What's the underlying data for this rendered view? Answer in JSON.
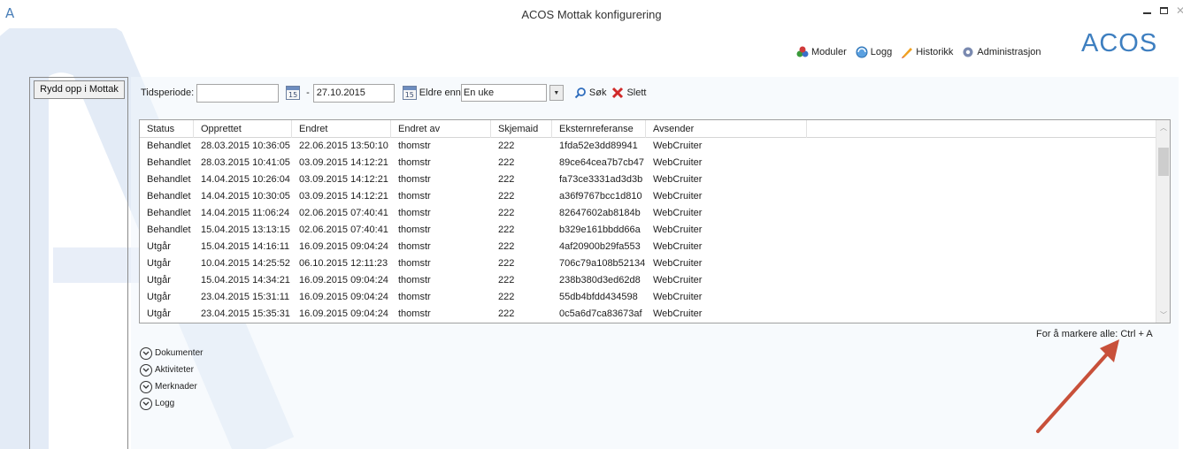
{
  "window": {
    "title": "ACOS Mottak konfigurering",
    "app_icon": "A"
  },
  "brand": {
    "logo_text": "ACOS",
    "accent": "#3e7fc0"
  },
  "topnav": {
    "items": [
      {
        "label": "Moduler",
        "icon": "modules-icon"
      },
      {
        "label": "Logg",
        "icon": "log-icon"
      },
      {
        "label": "Historikk",
        "icon": "history-icon"
      },
      {
        "label": "Administrasjon",
        "icon": "admin-icon"
      }
    ]
  },
  "leftpanel": {
    "button_label": "Rydd opp i Mottak"
  },
  "toolbar": {
    "period_label": "Tidsperiode:",
    "from_value": "",
    "dash": "-",
    "to_value": "27.10.2015",
    "cal_text": "15",
    "older_label": "Eldre enn",
    "older_value": "En uke",
    "search_label": "Søk",
    "delete_label": "Slett"
  },
  "grid": {
    "columns": [
      "Status",
      "Opprettet",
      "Endret",
      "Endret av",
      "Skjemaid",
      "Eksternreferanse",
      "Avsender"
    ],
    "rows": [
      [
        "Behandlet",
        "28.03.2015 10:36:05",
        "22.06.2015 13:50:10",
        "thomstr",
        "222",
        "1fda52e3dd89941",
        "WebCruiter"
      ],
      [
        "Behandlet",
        "28.03.2015 10:41:05",
        "03.09.2015 14:12:21",
        "thomstr",
        "222",
        "89ce64cea7b7cb47",
        "WebCruiter"
      ],
      [
        "Behandlet",
        "14.04.2015 10:26:04",
        "03.09.2015 14:12:21",
        "thomstr",
        "222",
        "fa73ce3331ad3d3b",
        "WebCruiter"
      ],
      [
        "Behandlet",
        "14.04.2015 10:30:05",
        "03.09.2015 14:12:21",
        "thomstr",
        "222",
        "a36f9767bcc1d810",
        "WebCruiter"
      ],
      [
        "Behandlet",
        "14.04.2015 11:06:24",
        "02.06.2015 07:40:41",
        "thomstr",
        "222",
        "82647602ab8184b",
        "WebCruiter"
      ],
      [
        "Behandlet",
        "15.04.2015 13:13:15",
        "02.06.2015 07:40:41",
        "thomstr",
        "222",
        "b329e161bbdd66a",
        "WebCruiter"
      ],
      [
        "Utgår",
        "15.04.2015 14:16:11",
        "16.09.2015 09:04:24",
        "thomstr",
        "222",
        "4af20900b29fa553",
        "WebCruiter"
      ],
      [
        "Utgår",
        "10.04.2015 14:25:52",
        "06.10.2015 12:11:23",
        "thomstr",
        "222",
        "706c79a108b52134",
        "WebCruiter"
      ],
      [
        "Utgår",
        "15.04.2015 14:34:21",
        "16.09.2015 09:04:24",
        "thomstr",
        "222",
        "238b380d3ed62d8",
        "WebCruiter"
      ],
      [
        "Utgår",
        "23.04.2015 15:31:11",
        "16.09.2015 09:04:24",
        "thomstr",
        "222",
        "55db4bfdd434598",
        "WebCruiter"
      ],
      [
        "Utgår",
        "23.04.2015 15:35:31",
        "16.09.2015 09:04:24",
        "thomstr",
        "222",
        "0c5a6d7ca83673af",
        "WebCruiter"
      ]
    ]
  },
  "hint": "For å markere alle: Ctrl + A",
  "expanders": [
    "Dokumenter",
    "Aktiviteter",
    "Merknader",
    "Logg"
  ],
  "annotation_arrow_color": "#c8503a"
}
